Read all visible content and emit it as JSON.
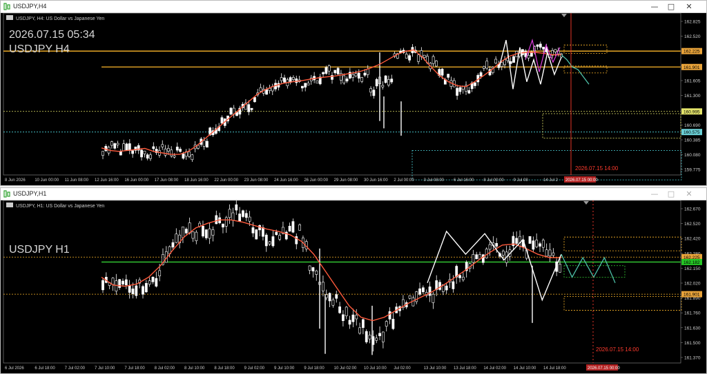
{
  "windows": {
    "top": {
      "title": "USDJPY,H4",
      "header_info": "USDJPY, H4:  US Dollar vs Japanese Yen",
      "timestamp": "2026.07.15 05:34",
      "label": "USDJPY H4",
      "vline_label": "2026.07.15 14:00",
      "y_ticks": [
        "162.825",
        "162.520",
        "162.225",
        "161.901",
        "161.605",
        "161.300",
        "160.995",
        "160.690",
        "160.385",
        "160.080",
        "159.775"
      ],
      "highlight_ticks": [
        {
          "text": "162.225",
          "bg": "#e8a33a"
        },
        {
          "text": "161.901",
          "bg": "#e8a33a"
        },
        {
          "text": "160.995",
          "bg": "#e3e36a"
        },
        {
          "text": "160.575",
          "bg": "#6bd0d6"
        }
      ],
      "x_ticks": [
        "8 Jun 2026",
        "10 Jun 00:00",
        "11 Jun 08:00",
        "12 Jun 16:00",
        "16 Jun 00:00",
        "17 Jun 08:00",
        "18 Jun 16:00",
        "22 Jun 00:00",
        "23 Jun 08:00",
        "24 Jun 16:00",
        "26 Jun 00:00",
        "29 Jun 08:00",
        "30 Jun 16:00",
        "2 Jul 00:00",
        "3 Jul 08:00",
        "6 Jul 16:00",
        "8 Jul 00:00",
        "9 Jul 08",
        "14 Jul 2"
      ],
      "x_highlight": "2026.07.15 00:00"
    },
    "bottom": {
      "title": "USDJPY,H1",
      "header_info": "USDJPY, H1:  US Dollar vs Japanese Yen",
      "label": "USDJPY H1",
      "vline_label": "2026.07.15 14:00",
      "y_ticks": [
        "162.670",
        "162.520",
        "162.420",
        "162.280",
        "162.150",
        "162.020",
        "161.890",
        "161.760",
        "161.630",
        "161.500",
        "161.370"
      ],
      "highlight_ticks": [
        {
          "text": "162.225",
          "bg": "#e8a33a"
        },
        {
          "text": "162.182",
          "bg": "#26c526"
        },
        {
          "text": "161.901",
          "bg": "#e8a33a"
        }
      ],
      "x_ticks": [
        "6 Jul 2026",
        "6 Jul 18:00",
        "7 Jul 02:00",
        "7 Jul 10:00",
        "7 Jul 18:00",
        "8 Jul 02:00",
        "8 Jul 10:00",
        "8 Jul 18:00",
        "9 Jul 02:00",
        "9 Jul 10:00",
        "9 Jul 18:00",
        "10 Jul 02:00",
        "10 Jul 10:00",
        "Jul 02:00",
        "13 Jul 10:00",
        "13 Jul 18:00",
        "14 Jul 02:00",
        "14 Jul 10:00",
        "14 Jul 18:00"
      ],
      "x_highlight": "2026.07.15 00:00"
    }
  },
  "colors": {
    "background": "#000000",
    "candle": "#ffffff",
    "moving_average": "#ff5a3c",
    "level_orange": "#ffb82a",
    "level_green": "#35d435",
    "level_yellow_dotted": "#e8e86a",
    "level_cyan_dotted": "#4fd8e0",
    "forecast_teal": "#4ec0a8",
    "zigzag_white": "#ffffff",
    "zigzag_magenta": "#e040e0",
    "vline_red": "#ff3b2e"
  },
  "chart_data": [
    {
      "type": "candlestick",
      "title": "USDJPY H4",
      "symbol": "USDJPY",
      "timeframe": "H4",
      "ylim": [
        159.7,
        163.0
      ],
      "ma_values": [
        160.25,
        160.2,
        160.18,
        160.2,
        160.22,
        160.24,
        160.18,
        160.15,
        160.12,
        160.12,
        160.18,
        160.3,
        160.45,
        160.6,
        160.75,
        160.9,
        161.05,
        161.2,
        161.35,
        161.45,
        161.52,
        161.57,
        161.6,
        161.62,
        161.65,
        161.68,
        161.7,
        161.72,
        161.75,
        161.78,
        161.82,
        161.88,
        161.95,
        162.05,
        162.15,
        162.22,
        162.25,
        162.1,
        161.9,
        161.72,
        161.6,
        161.52,
        161.5,
        161.6,
        161.72,
        161.85,
        162.0,
        162.12,
        162.18,
        162.2,
        162.2,
        162.18,
        162.15,
        162.15
      ],
      "levels": [
        162.225,
        161.901,
        160.995,
        160.575
      ],
      "zigzag": [
        161.9,
        162.45,
        161.45,
        162.3,
        161.6,
        162.05,
        161.55,
        162.2,
        161.75,
        162.1
      ],
      "forecast": [
        162.15,
        162.05,
        161.9,
        161.85,
        161.7,
        161.55
      ]
    },
    {
      "type": "candlestick",
      "title": "USDJPY H1",
      "symbol": "USDJPY",
      "timeframe": "H1",
      "ylim": [
        161.3,
        162.72
      ],
      "ma_values": [
        162.05,
        161.98,
        161.97,
        161.99,
        162.05,
        162.15,
        162.28,
        162.4,
        162.48,
        162.52,
        162.55,
        162.55,
        162.53,
        162.5,
        162.47,
        162.45,
        162.42,
        162.36,
        162.25,
        162.1,
        161.95,
        161.8,
        161.7,
        161.67,
        161.7,
        161.76,
        161.82,
        161.87,
        161.92,
        161.98,
        162.05,
        162.12,
        162.2,
        162.27,
        162.33,
        162.34,
        162.3,
        162.25,
        162.22,
        162.22
      ],
      "levels": [
        162.225,
        162.182,
        161.901
      ],
      "zigzag": [
        162.0,
        162.45,
        162.25,
        162.43,
        162.2,
        162.38,
        161.85,
        162.25
      ],
      "forecast": [
        162.25,
        162.05,
        162.22,
        162.05,
        162.22,
        162.0
      ]
    }
  ]
}
